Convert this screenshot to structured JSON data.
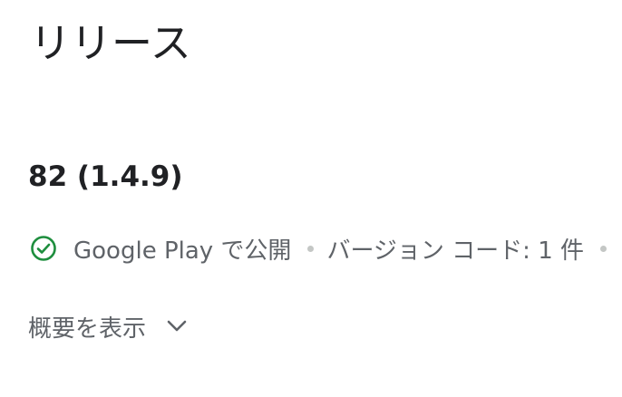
{
  "page": {
    "title": "リリース"
  },
  "release": {
    "title": "82 (1.4.9)",
    "status": {
      "icon": "check-circle-icon",
      "color": "#1e8e3e",
      "label": "Google Play で公開"
    },
    "version_codes": "バージョン コード: 1 件"
  },
  "summary_toggle": {
    "label": "概要を表示",
    "icon": "chevron-down-icon"
  }
}
